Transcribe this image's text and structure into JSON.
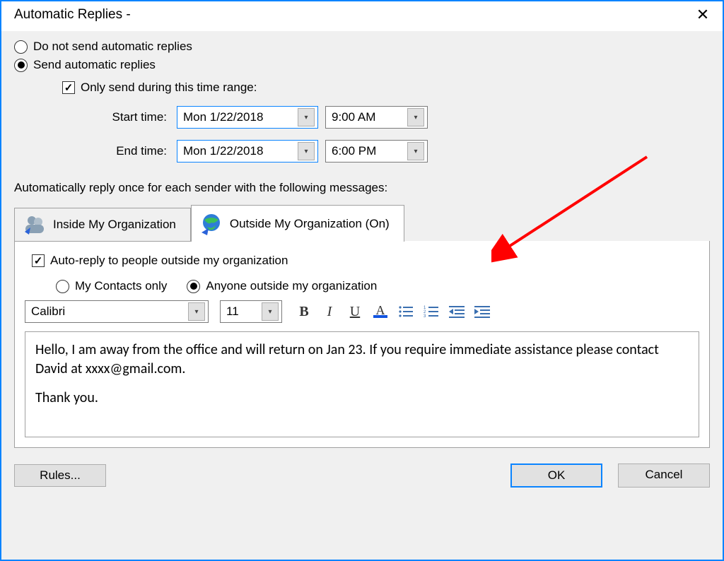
{
  "window": {
    "title": "Automatic Replies -"
  },
  "options": {
    "no_send_label": "Do not send automatic replies",
    "send_label": "Send automatic replies",
    "only_range_label": "Only send during this time range:",
    "start_label": "Start time:",
    "end_label": "End time:",
    "start_date": "Mon 1/22/2018",
    "end_date": "Mon 1/22/2018",
    "start_time": "9:00 AM",
    "end_time": "6:00 PM"
  },
  "section_msg": "Automatically reply once for each sender with the following messages:",
  "tabs": {
    "inside_label": "Inside My Organization",
    "outside_label": "Outside My Organization (On)"
  },
  "panel": {
    "auto_reply_outside_label": "Auto-reply to people outside my organization",
    "contacts_only_label": "My Contacts only",
    "anyone_label": "Anyone outside my organization",
    "font_name": "Calibri",
    "font_size": "11",
    "body_line1": "Hello, I am away from the office and will return on Jan 23. If you require immediate assistance please contact David at xxxx@gmail.com.",
    "body_line2": "Thank you."
  },
  "buttons": {
    "rules": "Rules...",
    "ok": "OK",
    "cancel": "Cancel"
  }
}
